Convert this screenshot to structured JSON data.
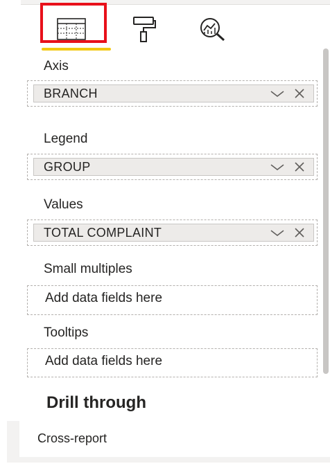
{
  "toolbar": {
    "tabs": [
      {
        "name": "fields",
        "icon": "fields-grid-icon",
        "active": true
      },
      {
        "name": "format",
        "icon": "paint-roller-icon",
        "active": false
      },
      {
        "name": "analytics",
        "icon": "analytics-magnifier-icon",
        "active": false
      }
    ],
    "highlight_color": "#e8101a",
    "active_underline_color": "#f2c811"
  },
  "wells": {
    "axis": {
      "label": "Axis",
      "field": "BRANCH"
    },
    "legend": {
      "label": "Legend",
      "field": "GROUP"
    },
    "values": {
      "label": "Values",
      "field": "TOTAL COMPLAINT"
    },
    "small_multiples": {
      "label": "Small multiples",
      "placeholder": "Add data fields here"
    },
    "tooltips": {
      "label": "Tooltips",
      "placeholder": "Add data fields here"
    }
  },
  "drill_through": {
    "title": "Drill through",
    "cross_report_label": "Cross-report"
  }
}
